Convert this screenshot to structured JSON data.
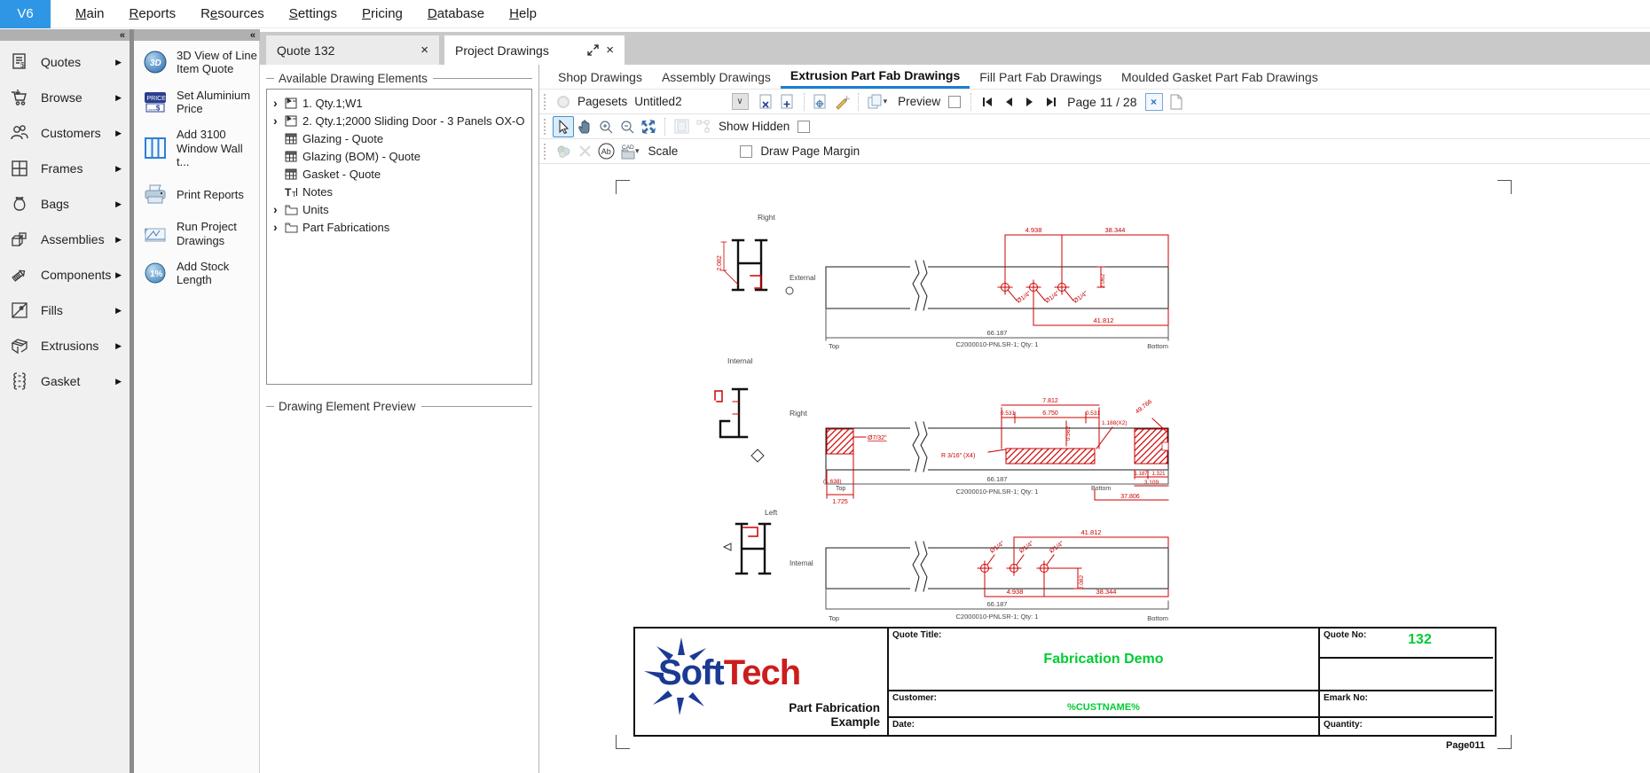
{
  "colors": {
    "accent_blue": "#2e96e4",
    "tab_underline": "#1b7fd4",
    "drawing_red": "#cc0000",
    "value_green": "#00cc33",
    "logo_blue": "#1b3a94",
    "logo_red": "#cc1d1d"
  },
  "glyphs": {
    "collapse": "«",
    "submenu_arrow": "▶",
    "tree_expander": "›",
    "combo_arrow": "∨",
    "dropdown": "▾",
    "close": "×"
  },
  "menu": {
    "logo": "V6",
    "items": [
      {
        "pre": "",
        "key": "M",
        "post": "ain"
      },
      {
        "pre": "",
        "key": "R",
        "post": "eports"
      },
      {
        "pre": "R",
        "key": "e",
        "post": "sources"
      },
      {
        "pre": "",
        "key": "S",
        "post": "ettings"
      },
      {
        "pre": "",
        "key": "P",
        "post": "ricing"
      },
      {
        "pre": "",
        "key": "D",
        "post": "atabase"
      },
      {
        "pre": "",
        "key": "H",
        "post": "elp"
      }
    ]
  },
  "sidebar": {
    "items": [
      {
        "label": "Quotes"
      },
      {
        "label": "Browse"
      },
      {
        "label": "Customers"
      },
      {
        "label": "Frames"
      },
      {
        "label": "Bags"
      },
      {
        "label": "Assemblies"
      },
      {
        "label": "Components"
      },
      {
        "label": "Fills"
      },
      {
        "label": "Extrusions"
      },
      {
        "label": "Gasket"
      }
    ]
  },
  "actions": {
    "items": [
      {
        "label": "3D View of Line Item Quote"
      },
      {
        "label": "Set Aluminium Price"
      },
      {
        "label": "Add 3100 Window Wall t..."
      },
      {
        "label": "Print Reports"
      },
      {
        "label": "Run Project Drawings"
      },
      {
        "label": "Add Stock Length"
      }
    ],
    "icon_text": {
      "threed": "3D",
      "price": "PRICE",
      "price_row": "....$",
      "stock": "1%"
    }
  },
  "tabs": {
    "quote": "Quote 132",
    "project": "Project Drawings"
  },
  "tree": {
    "legend": "Available Drawing Elements",
    "items": [
      {
        "label": "1. Qty.1;W1"
      },
      {
        "label": "2. Qty.1;2000 Sliding Door - 3 Panels OX-O"
      },
      {
        "label": "Glazing - Quote"
      },
      {
        "label": "Glazing (BOM) - Quote"
      },
      {
        "label": "Gasket - Quote"
      },
      {
        "label": "Notes"
      },
      {
        "label": "Units"
      },
      {
        "label": "Part Fabrications"
      }
    ],
    "notes_icon_text": "T"
  },
  "preview": {
    "legend": "Drawing Element Preview"
  },
  "drawing_tabs": [
    {
      "label": "Shop Drawings"
    },
    {
      "label": "Assembly Drawings"
    },
    {
      "label": "Extrusion Part Fab Drawings"
    },
    {
      "label": "Fill Part Fab Drawings"
    },
    {
      "label": "Moulded Gasket Part Fab Drawings"
    }
  ],
  "toolbar1": {
    "pagesets_label": "Pagesets",
    "pageset_value": "Untitled2",
    "preview_label": "Preview",
    "page_indicator": "Page 11 / 28"
  },
  "toolbar2": {
    "show_hidden_label": "Show Hidden"
  },
  "toolbar3": {
    "scale_label": "Scale",
    "draw_page_margin_label": "Draw Page Margin",
    "ab_icon_text": "Ab",
    "cad_icon_text": "CAD"
  },
  "drawings": {
    "d1": {
      "view": "Right",
      "side": "External",
      "profile_dim": "2.082",
      "dim_a": "4.938",
      "dim_b": "38.344",
      "dim_v": "2.062",
      "dim_c": "41.812",
      "hole": "Ø1/4\"",
      "len": "66.187",
      "part": "C2000010-PNLSR-1; Qty: 1",
      "top": "Top",
      "bottom": "Bottom"
    },
    "d2": {
      "view": "Internal",
      "side": "Right",
      "dim_total": "7.812",
      "dim_1": "0.531",
      "dim_2": "6.750",
      "dim_3": "0.531",
      "dim_v": "0.562",
      "dim_x2": "1.188(X2)",
      "dim_diag": "49.766",
      "callout": "Ø7/32\"",
      "radius_note": "R 3/16\" (X4)",
      "dim_l1": "(1.638)",
      "dim_l2": "1.725",
      "len": "66.187",
      "part": "C2000010-PNLSR-1; Qty: 1",
      "dim_r1": "1.187",
      "dim_r2": "1.321",
      "dim_r3": "3.109",
      "dim_r4": "37.806",
      "top": "Top",
      "bottom": "Bottom"
    },
    "d3": {
      "view": "Left",
      "side": "Internal",
      "dim_a": "41.812",
      "dim_v": "2.082",
      "dim_b": "4.938",
      "dim_c": "38.344",
      "hole": "Ø1/4\"",
      "len": "66.187",
      "part": "C2000010-PNLSR-1; Qty: 1",
      "top": "Top",
      "bottom": "Bottom"
    }
  },
  "title_block": {
    "logo_soft": "Soft",
    "logo_tech": "Tech",
    "subtitle_line1": "Part Fabrication",
    "subtitle_line2": "Example",
    "quote_title_label": "Quote Title:",
    "quote_title": "Fabrication Demo",
    "customer_label": "Customer:",
    "customer": "%CUSTNAME%",
    "date_label": "Date:",
    "quote_no_label": "Quote No:",
    "quote_no": "132",
    "emark_label": "Emark No:",
    "quantity_label": "Quantity:",
    "page_number": "Page011"
  }
}
